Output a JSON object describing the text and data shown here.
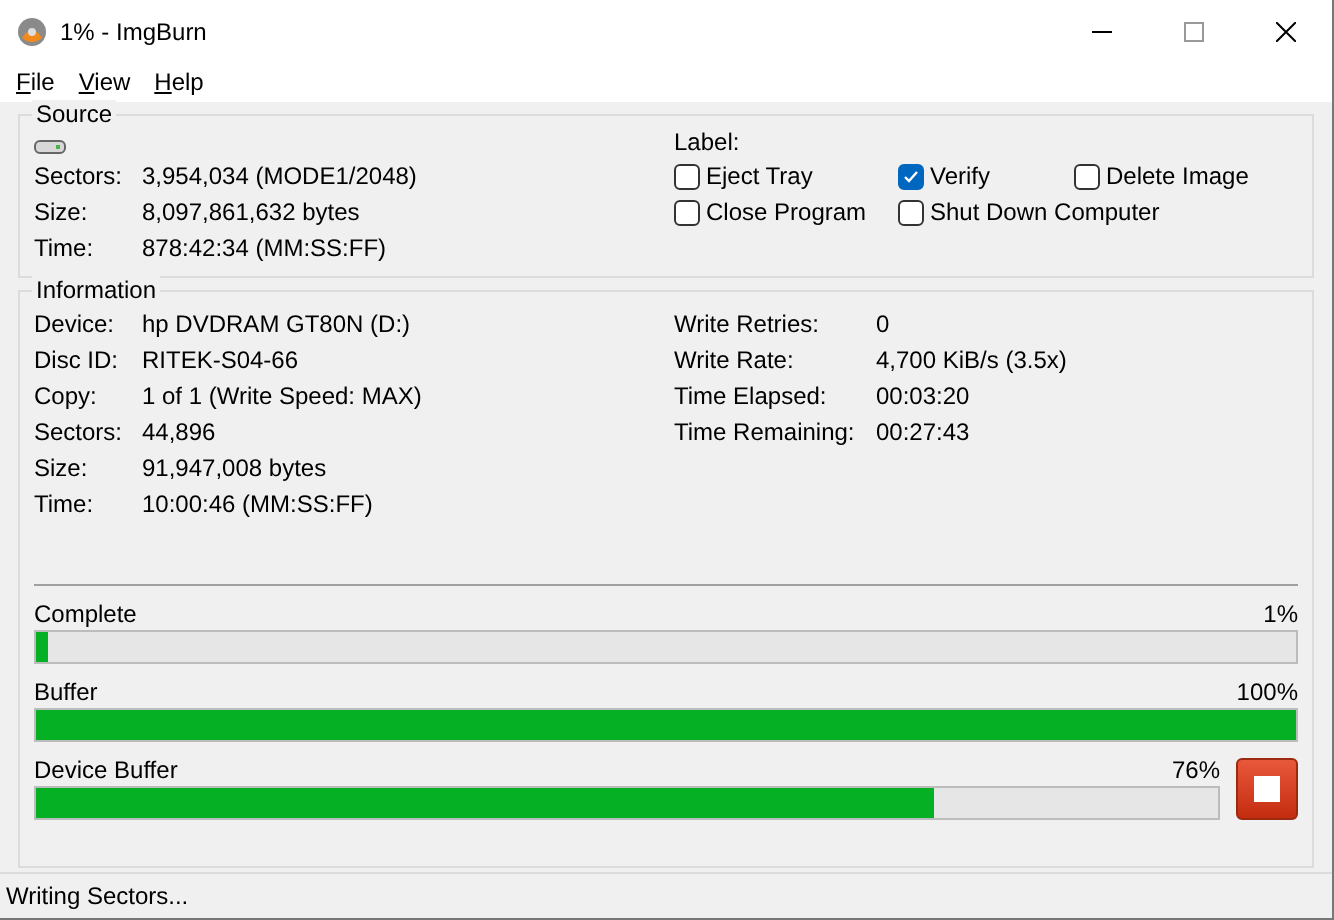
{
  "window": {
    "title": "1% - ImgBurn"
  },
  "menu": [
    "File",
    "View",
    "Help"
  ],
  "source": {
    "legend": "Source",
    "fields": [
      {
        "label": "Sectors:",
        "value": "3,954,034 (MODE1/2048)"
      },
      {
        "label": "Size:",
        "value": "8,097,861,632 bytes"
      },
      {
        "label": "Time:",
        "value": "878:42:34 (MM:SS:FF)"
      }
    ],
    "label_caption": "Label:",
    "options": [
      {
        "label": "Eject Tray",
        "checked": false
      },
      {
        "label": "Verify",
        "checked": true
      },
      {
        "label": "Delete Image",
        "checked": false
      },
      {
        "label": "Close Program",
        "checked": false
      },
      {
        "label": "Shut Down Computer",
        "checked": false
      }
    ]
  },
  "information": {
    "legend": "Information",
    "left": [
      {
        "label": "Device:",
        "value": "hp DVDRAM GT80N (D:)"
      },
      {
        "label": "Disc ID:",
        "value": "RITEK-S04-66"
      },
      {
        "label": "Copy:",
        "value": "1 of 1 (Write Speed: MAX)"
      },
      {
        "label": "Sectors:",
        "value": "44,896"
      },
      {
        "label": "Size:",
        "value": "91,947,008 bytes"
      },
      {
        "label": "Time:",
        "value": "10:00:46 (MM:SS:FF)"
      }
    ],
    "right": [
      {
        "label": "Write Retries:",
        "value": "0"
      },
      {
        "label": "Write Rate:",
        "value": "4,700 KiB/s (3.5x)"
      },
      {
        "label": "Time Elapsed:",
        "value": "00:03:20"
      },
      {
        "label": "Time Remaining:",
        "value": "00:27:43"
      }
    ],
    "progress": [
      {
        "label": "Complete",
        "reading": "1%",
        "level": 0.01
      },
      {
        "label": "Buffer",
        "reading": "100%",
        "level": 1.0
      },
      {
        "label": "Device Buffer",
        "reading": "76%",
        "level": 0.76
      }
    ]
  },
  "status_bar": "Writing Sectors..."
}
